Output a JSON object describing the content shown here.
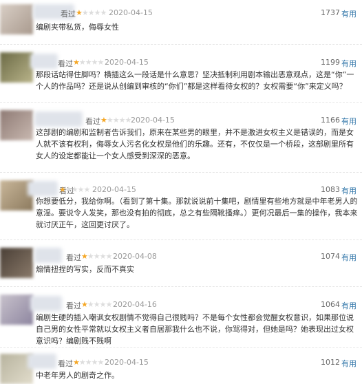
{
  "reviews": [
    {
      "status": "看过",
      "stars": 1,
      "date": "2020-04-15",
      "votes": "1737",
      "useful": "有用",
      "text": "编剧夹带私货，侮辱女性",
      "c1": "#d9cfc6",
      "c2": "#a99a8e"
    },
    {
      "status": "看过",
      "stars": 1,
      "date": "2020-04-15",
      "votes": "1199",
      "useful": "有用",
      "text": "那段话站得住脚吗？横插这么一段话是什么意思？坚决抵制利用剧本输出恶意观点，这是“你”一个人的作品吗？还是说从创编到审核的“你们”都是这样看待女权的？女权需要“你”来定义吗？",
      "c1": "#6b6a45",
      "c2": "#b9b48a"
    },
    {
      "status": "看过",
      "stars": 1,
      "date": "2020-04-15",
      "votes": "1166",
      "useful": "有用",
      "text": "这部剧的编剧和监制者告诉我们，原来在某些男的眼里，并不是激进女权主义是错误的，而是女人就不该有权利，侮辱女人污名化女权是他们的乐趣。还有，不仅仅是一个桥段，这部剧里所有女人的设定都能让一个女人感受到深深的恶意。",
      "c1": "#8e7a74",
      "c2": "#c9b9b1"
    },
    {
      "status": "看过",
      "stars": 1,
      "date": "2020-04-15",
      "votes": "1083",
      "useful": "有用",
      "text": "你想要低分，我给你啊。（看到了第十集。那就说说前十集吧，剧情里有些地方就是中年老男人的意淫。要说令人发笑，那也没有拍的彻底，总之有些隔靴搔痒。）更何况最后一集的操作，我本来就讨厌正午，这回更讨厌了。",
      "c1": "#c9b79a",
      "c2": "#8c7a5e"
    },
    {
      "status": "看过",
      "stars": 1,
      "date": "2020-04-08",
      "votes": "1074",
      "useful": "有用",
      "text": "煽情扭捏的写实，反而不真实",
      "c1": "#4a3f36",
      "c2": "#8a7a6a"
    },
    {
      "status": "看过",
      "stars": 1,
      "date": "2020-04-16",
      "votes": "1064",
      "useful": "有用",
      "text": "编剧生硬的插入嘲讽女权剧情不觉得自己很贱吗？不是每个女性都会觉醒女权意识，如果那位说自己男的女性平常就以女权主义者自居那我什么也不说，你骂得对，但她是吗？她表现出过女权意识吗？编剧贱不贱啊",
      "c1": "#c8c2cc",
      "c2": "#8e86a0"
    },
    {
      "status": "看过",
      "stars": 1,
      "date": "2020-04-15",
      "votes": "1012",
      "useful": "有用",
      "text": "中老年男人的剧奇之作。",
      "c1": "#b7b39e",
      "c2": "#e2ddcc"
    }
  ]
}
